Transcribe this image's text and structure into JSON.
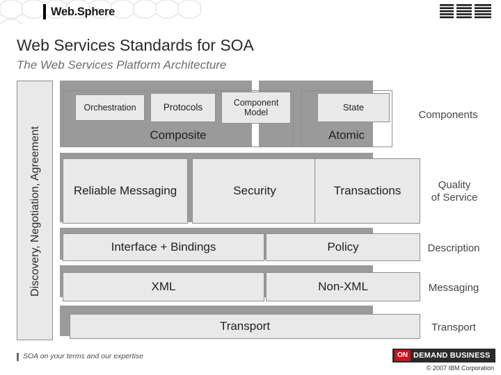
{
  "header": {
    "product_logo": "Web.Sphere",
    "brand_logo": "IBM"
  },
  "title": "Web Services Standards for SOA",
  "subtitle": "The Web Services Platform Architecture",
  "diagram": {
    "vertical_label": "Discovery, Negotiation, Agreement",
    "boxes": {
      "orchestration": "Orchestration",
      "protocols": "Protocols",
      "component_model": "Component Model",
      "state": "State",
      "composite": "Composite",
      "atomic": "Atomic",
      "reliable_messaging": "Reliable Messaging",
      "security": "Security",
      "transactions": "Transactions",
      "interface_bindings": "Interface + Bindings",
      "policy": "Policy",
      "xml": "XML",
      "non_xml": "Non-XML",
      "transport": "Transport"
    },
    "right_labels": {
      "components": "Components",
      "quality_of_service": "Quality\nof Service",
      "quality_of_service_line1": "Quality",
      "quality_of_service_line2": "of Service",
      "description": "Description",
      "messaging": "Messaging",
      "transport": "Transport"
    }
  },
  "footer": {
    "tagline": "SOA on your terms and our expertise",
    "badge_on": "ON",
    "badge_text": "DEMAND BUSINESS",
    "copyright": "© 2007 IBM Corporation"
  },
  "colors": {
    "box_fill": "#e9e9e9",
    "box_border": "#8e8e8e",
    "band_fill": "#9a9a9a",
    "title_text": "#2b2b2b",
    "subtitle_text": "#6d6d6d",
    "accent_red": "#cf1020"
  }
}
